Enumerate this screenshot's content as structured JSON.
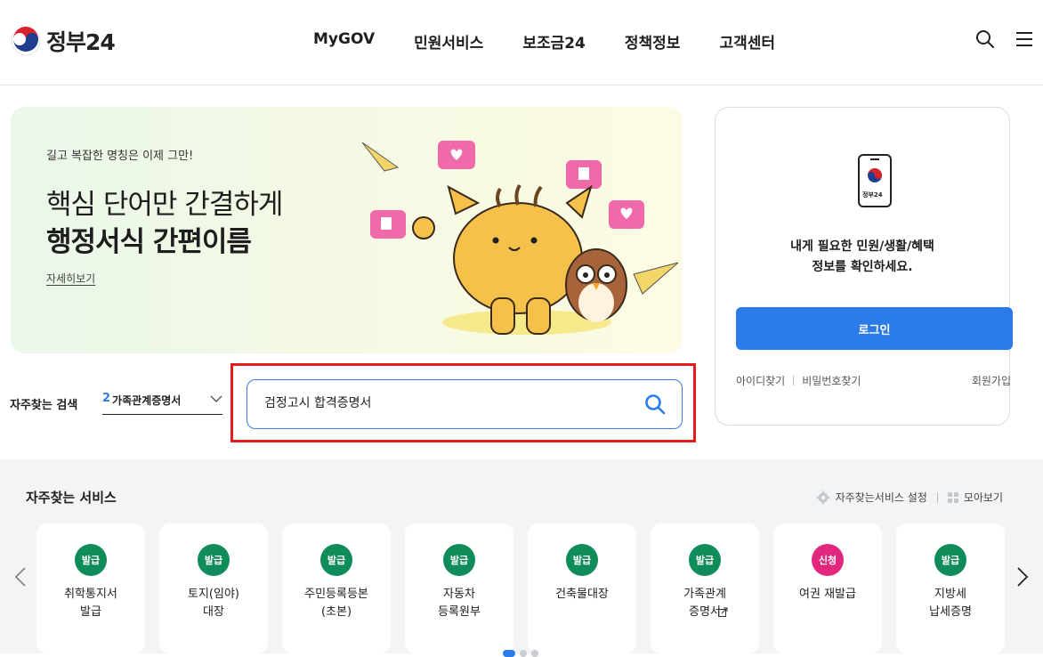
{
  "header": {
    "logo_text": "정부24",
    "nav": [
      "MyGOV",
      "민원서비스",
      "보조금24",
      "정책정보",
      "고객센터"
    ]
  },
  "banner": {
    "subtitle": "길고 복잡한 명칭은 이제 그만!",
    "headline_line1": "핵심 단어만 간결하게",
    "headline_line2": "행정서식 간편이름",
    "more_link": "자세히보기"
  },
  "login": {
    "device_label": "정부24",
    "message_line1": "내게 필요한 민원/생활/혜택",
    "message_line2": "정보를 확인하세요.",
    "login_button": "로그인",
    "find_id": "아이디찾기",
    "find_password": "비밀번호찾기",
    "signup": "회원가입"
  },
  "frequent_search": {
    "label": "자주찾는 검색",
    "rank": "2",
    "term": "가족관계증명서",
    "search_value": "검정고시 합격증명서"
  },
  "services": {
    "title": "자주찾는 서비스",
    "settings_label": "자주찾는서비스 설정",
    "view_all_label": "모아보기",
    "cards": [
      {
        "badge": "발급",
        "name": "취학통지서\n발급"
      },
      {
        "badge": "발급",
        "name": "토지(임야)\n대장"
      },
      {
        "badge": "발급",
        "name": "주민등록등본\n(초본)"
      },
      {
        "badge": "발급",
        "name": "자동차\n등록원부"
      },
      {
        "badge": "발급",
        "name": "건축물대장"
      },
      {
        "badge": "발급",
        "name": "가족관계\n증명서"
      },
      {
        "badge": "신청",
        "name": "여권 재발급"
      },
      {
        "badge": "발급",
        "name": "지방세\n납세증명"
      }
    ]
  },
  "colors": {
    "accent_blue": "#2b7ce9",
    "badge_green": "#0f8c5a",
    "badge_pink": "#e2277e",
    "highlight_red": "#e21b1b"
  }
}
